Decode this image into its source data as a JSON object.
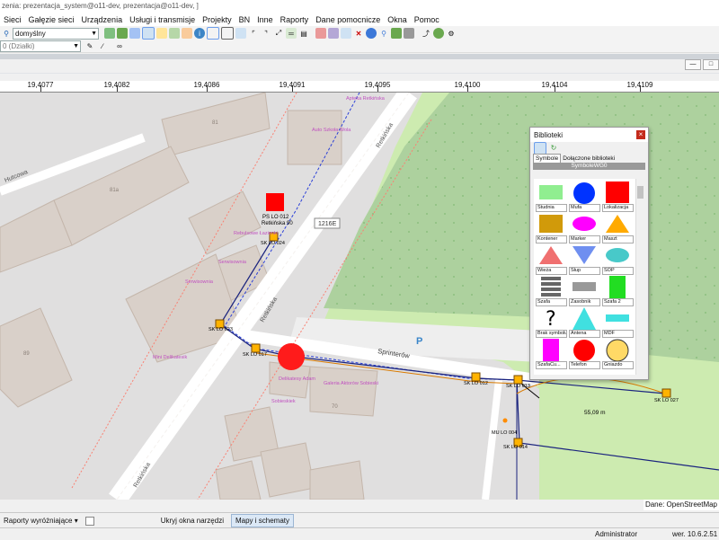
{
  "window": {
    "title": "zenia: prezentacja_system@o11-dev, prezentacja@o11-dev, ]"
  },
  "menu": [
    "Sieci",
    "Gałęzie sieci",
    "Urządzenia",
    "Usługi i transmisje",
    "Projekty",
    "BN",
    "Inne",
    "Raporty",
    "Dane pomocnicze",
    "Okna",
    "Pomoc"
  ],
  "toolbar": {
    "profile_value": "domyślny",
    "layer_value": "0 (Działki)"
  },
  "ruler": [
    "19,4077",
    "19,4082",
    "19,4086",
    "19,4091",
    "19,4095",
    "19,4100",
    "19,4104",
    "19,4109"
  ],
  "map": {
    "streets": {
      "hutcowa": "Hutcowa",
      "retkinska": "Retkińska",
      "sprinterow": "Sprinterów",
      "number": "1216E"
    },
    "pois": {
      "apteka": "Apteka Retkińska",
      "szkola": "Auto Szkoła Wola",
      "lazienki": "Rebulsowe Łazienki",
      "serwisownia1": "Serwisownia",
      "serwisownia2": "Serwisownia",
      "delikatesy": "Mini Delikatesik",
      "delikatesy_adam": "Delikatesy Adam",
      "sklepik": "Sobieskiek",
      "galeria": "Galeria Aktorów Sobieski"
    },
    "buildings": {
      "b81": "81",
      "b81a": "81a",
      "b89": "89",
      "b70": "70"
    },
    "labels": {
      "ps": "PS LO 012",
      "ps_addr": "Retkińska 90",
      "sk024": "SK LO 024",
      "sk023": "SK LO 023",
      "sk017": "SK LO 017",
      "sk012": "SK LO 012",
      "sk013": "SK LO 013",
      "sk014": "SK LO 014",
      "sk027": "SK LO 027",
      "mu": "MU LO 004",
      "dist": "55,09 m",
      "parking": "P"
    },
    "attribution": "Dane: OpenStreetMap"
  },
  "biblioteki": {
    "title": "Biblioteki",
    "tabs": [
      "Symbole",
      "Dołączone biblioteki"
    ],
    "header": "SymboleWG0",
    "symbols": [
      "Studnia",
      "Mufa",
      "Lokalizacja",
      "Kontener",
      "Marker",
      "Maszt",
      "Wieża",
      "Słup",
      "SOP",
      "Szafa",
      "Zasobnik",
      "Szafa 2",
      "Brak symbolu",
      "Antena",
      "MDF",
      "SzafaCu...",
      "Telefon",
      "Gniazdo"
    ]
  },
  "bottom": {
    "reports_label": "Raporty wyróżniające",
    "hide_tools": "Ukryj okna narzędzi",
    "maps_tab": "Mapy i schematy"
  },
  "status": {
    "user": "Administrator",
    "version": "wer. 10.6.2.51"
  }
}
